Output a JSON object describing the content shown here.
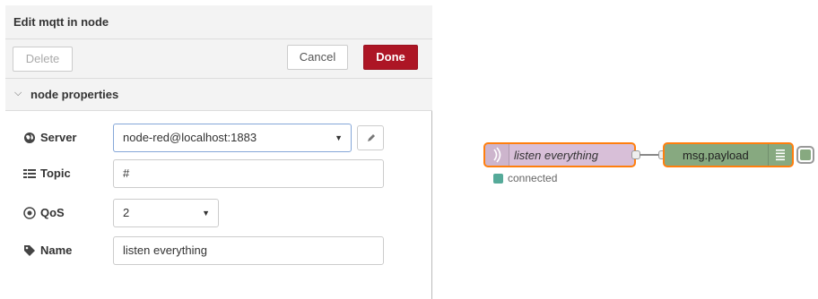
{
  "tray": {
    "title": "Edit mqtt in node",
    "buttons": {
      "delete": "Delete",
      "cancel": "Cancel",
      "done": "Done"
    },
    "section": {
      "title": "node properties",
      "expanded": true
    },
    "fields": {
      "server": {
        "label": "Server",
        "value": "node-red@localhost:1883",
        "icon": "globe-icon"
      },
      "topic": {
        "label": "Topic",
        "value": "#",
        "icon": "tasks-icon"
      },
      "qos": {
        "label": "QoS",
        "value": "2",
        "icon": "qos-icon"
      },
      "name": {
        "label": "Name",
        "value": "listen everything",
        "icon": "tag-icon"
      }
    }
  },
  "flow": {
    "mqtt_node": {
      "label": "listen everything",
      "icon": "bridge-icon",
      "color": "#d8bfd8"
    },
    "debug_node": {
      "label": "msg.payload",
      "icon": "debug-menu-icon",
      "color": "#87a980"
    },
    "status": {
      "text": "connected",
      "color": "#5a9"
    },
    "selection_color": "#ff7f0e"
  },
  "colors": {
    "done_button": "#ad1625"
  }
}
